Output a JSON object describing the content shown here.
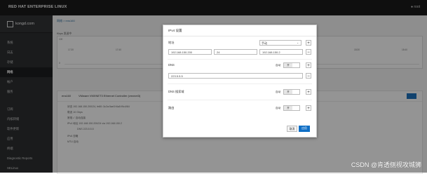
{
  "topbar": {
    "brand": "RED HAT ENTERPRISE LINUX",
    "user": "root"
  },
  "sidebar": {
    "host": "kongd.com",
    "items_group1": [
      "系统",
      "日志",
      "存储",
      "网络",
      "帐户",
      "服务"
    ],
    "items_group2": [
      "订阅",
      "内核转储",
      "软件更新",
      "应用",
      "终端",
      "Diagnostic Reports",
      "SELinux"
    ],
    "active": "网络"
  },
  "main": {
    "breadcrumb": "网络 > ens160",
    "chart_label": "Kbps 发送中",
    "chart_ticks": [
      "100",
      "0"
    ],
    "x_ticks": [
      "17:30",
      "17:40",
      "17:50",
      "18:00",
      "18:10",
      "18:20",
      "18:30",
      "18:40"
    ],
    "interface": "ens160",
    "interface_desc": "VMware VMXNET3 Ethernet Controller (vmxnet3)",
    "details": [
      "状态  192.168.150.200/24, fe80::3c2a:5ae3:f4a5:f9c4/64",
      "载波  10 Gbps",
      "常规  ✓ 自动连接",
      "IPv4  地址 192.168.150.200/24 via 192.168.150.2",
      "DNS 223.5.5.5",
      "IPv6  忽略",
      "MTU  自动"
    ]
  },
  "modal": {
    "title": "IPv4 设置",
    "address_label": "地址",
    "method": "手动",
    "address": "192.168.150.200",
    "prefix": "24",
    "gateway": "192.168.150.2",
    "dns_label": "DNS",
    "dns_value": "223.5.5.5",
    "dns_search_label": "DNS 搜索域",
    "routes_label": "路由",
    "auto_label": "自动",
    "toggle_text": "开",
    "plus": "+",
    "minus": "−",
    "cancel": "取消",
    "apply": "应用"
  },
  "watermark": "CSDN @肯透侧视攻城狮"
}
